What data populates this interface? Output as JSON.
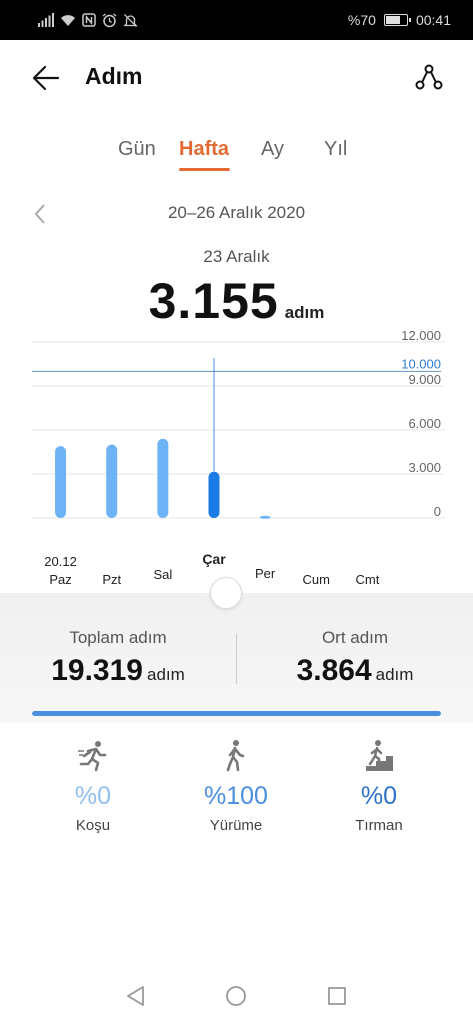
{
  "status_bar": {
    "battery_text": "%70",
    "time": "00:41",
    "icons": [
      "signal-icon",
      "wifi-icon",
      "nfc-icon",
      "alarm-icon",
      "silent-icon"
    ],
    "battery_level": 0.7
  },
  "header": {
    "title": "Adım",
    "back_icon": "arrow-left-icon",
    "route_icon": "route-icon"
  },
  "tabs": [
    {
      "label": "Gün",
      "active": false
    },
    {
      "label": "Hafta",
      "active": true
    },
    {
      "label": "Ay",
      "active": false
    },
    {
      "label": "Yıl",
      "active": false
    }
  ],
  "range": {
    "text": "20–26 Aralık 2020"
  },
  "selection": {
    "date": "23 Aralık",
    "value": "3.155",
    "unit": "adım"
  },
  "chart_data": {
    "type": "bar",
    "categories": [
      "Paz",
      "Pzt",
      "Sal",
      "Çar",
      "Per",
      "Cum",
      "Cmt"
    ],
    "category_dates": [
      "20.12",
      "",
      "",
      "",
      "",
      "",
      ""
    ],
    "values": [
      4900,
      5000,
      5400,
      3155,
      150,
      0,
      0
    ],
    "selected_index": 3,
    "ylim": [
      0,
      12000
    ],
    "yticks": [
      "12.000",
      "9.000",
      "6.000",
      "3.000",
      "0"
    ],
    "ytick_values": [
      12000,
      9000,
      6000,
      3000,
      0
    ],
    "goal": 10000,
    "goal_label": "10.000",
    "bar_color": "#6eb3f5",
    "selected_bar_color": "#1a7ae6",
    "goal_color": "#5d95c2"
  },
  "stats": {
    "total_label": "Toplam adım",
    "total_value": "19.319",
    "total_unit": "adım",
    "avg_label": "Ort adım",
    "avg_value": "3.864",
    "avg_unit": "adım"
  },
  "progress": {
    "fraction": 1.0,
    "color": "#4a8fe0"
  },
  "activities": [
    {
      "pct": "%0",
      "label": "Koşu",
      "icon": "running-icon",
      "color": "#8fc0ee"
    },
    {
      "pct": "%100",
      "label": "Yürüme",
      "icon": "walking-icon",
      "color": "#4a8fe0"
    },
    {
      "pct": "%0",
      "label": "Tırman",
      "icon": "climbing-icon",
      "color": "#2f73c9"
    }
  ],
  "navbar": {
    "icons": [
      "back-nav-icon",
      "home-nav-icon",
      "recents-nav-icon"
    ]
  }
}
